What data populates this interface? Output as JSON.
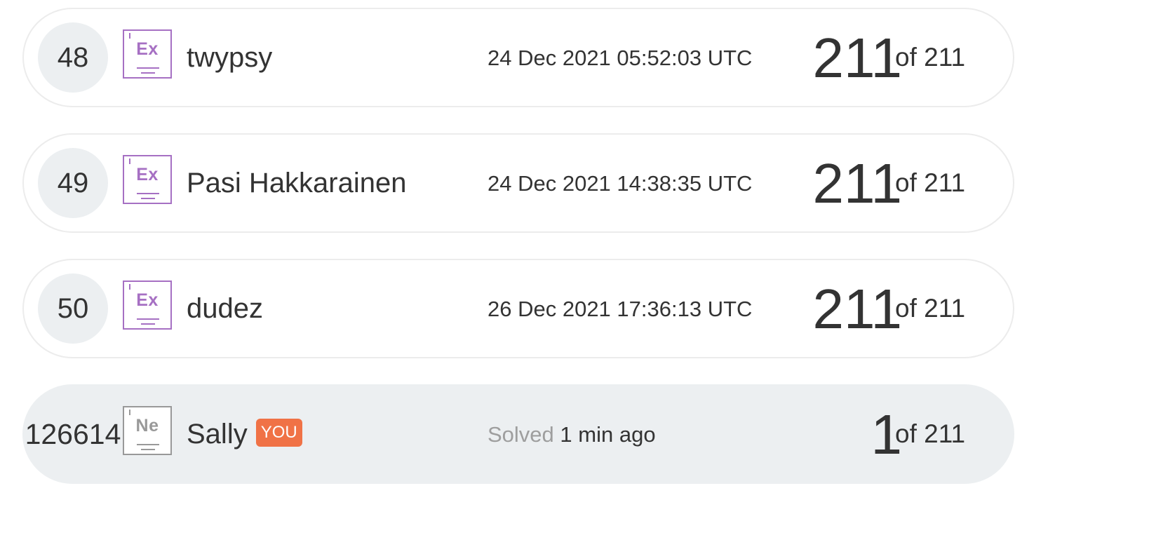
{
  "rows": [
    {
      "rank": "48",
      "element_symbol": "Ex",
      "name": "twypsy",
      "timestamp": "24 Dec 2021 05:52:03 UTC",
      "score": "211",
      "of_total": "of 211"
    },
    {
      "rank": "49",
      "element_symbol": "Ex",
      "name": "Pasi Hakkarainen",
      "timestamp": "24 Dec 2021 14:38:35 UTC",
      "score": "211",
      "of_total": "of 211"
    },
    {
      "rank": "50",
      "element_symbol": "Ex",
      "name": "dudez",
      "timestamp": "26 Dec 2021 17:36:13 UTC",
      "score": "211",
      "of_total": "of 211"
    }
  ],
  "current_user": {
    "rank": "126614",
    "element_symbol": "Ne",
    "name": "Sally",
    "you_badge": "YOU",
    "solved_label": "Solved",
    "solved_time": "1 min ago",
    "score": "1",
    "of_total": "of 211"
  },
  "colors": {
    "expert_badge": "#a670c3",
    "newbie_badge": "#999999",
    "you_badge_bg": "#f07246",
    "highlight_row_bg": "#eceff1"
  }
}
